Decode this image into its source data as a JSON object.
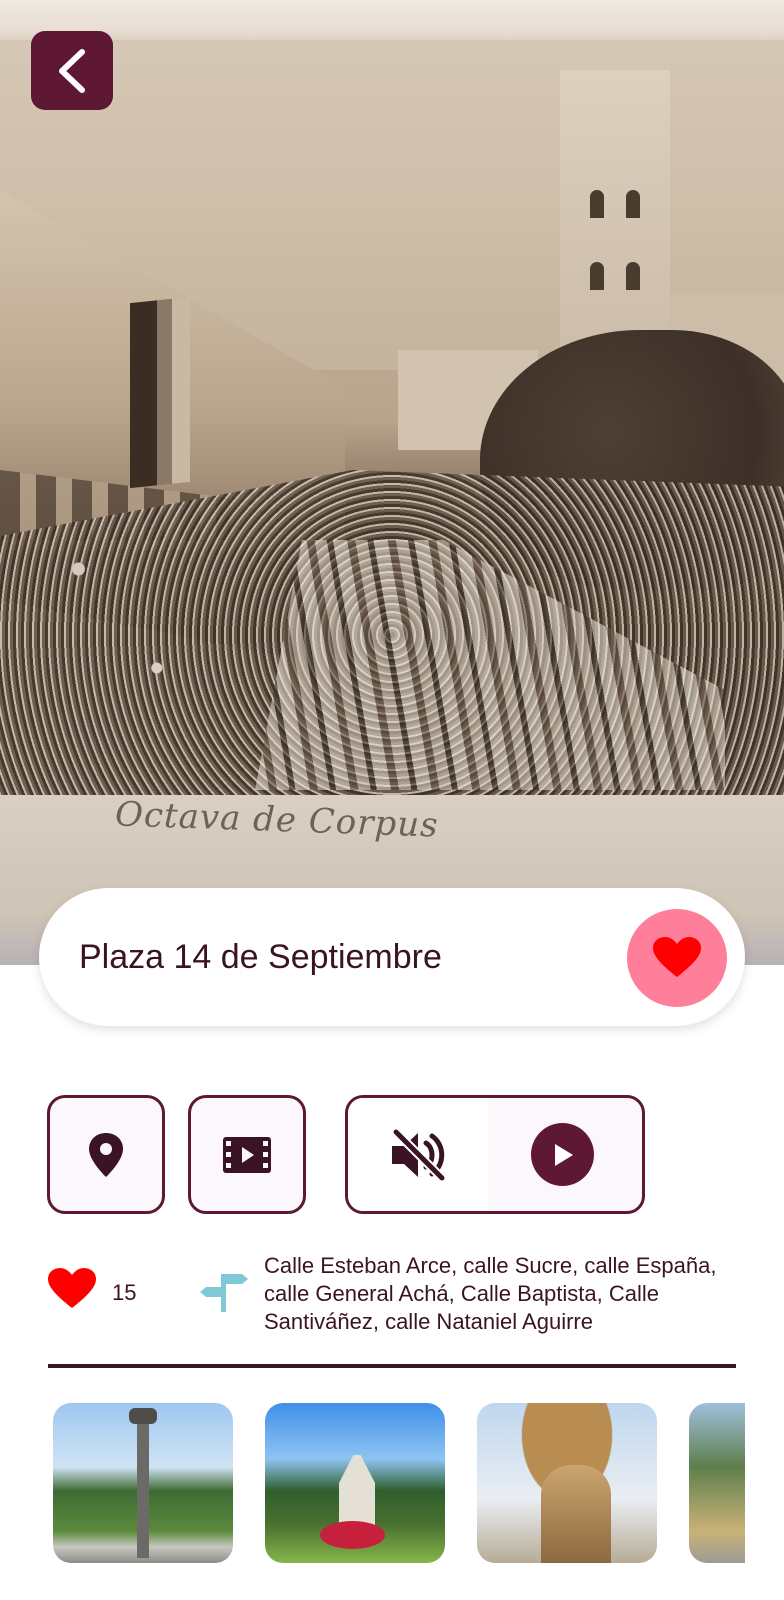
{
  "hero": {
    "image_alt": "Historical sepia photograph of a procession in the plaza",
    "caption": "Octava de Corpus"
  },
  "navigation": {
    "back_icon": "chevron-left-icon"
  },
  "place": {
    "title": "Plaza 14 de Septiembre",
    "favorite_icon": "heart-icon"
  },
  "actions": {
    "location_icon": "map-pin-icon",
    "video_icon": "film-icon",
    "mute_icon": "volume-mute-icon",
    "play_icon": "play-icon"
  },
  "info": {
    "likes_count": "15",
    "streets": "Calle Esteban Arce, calle Sucre, calle España, calle General Achá, Calle Baptista, Calle Santiváñez, calle Nataniel Aguirre"
  },
  "colors": {
    "primary": "#5e1833",
    "favorite_bg": "#ff7e9a",
    "heart": "#ff0000",
    "signpost": "#7ec8d8"
  },
  "gallery": {
    "items": [
      {
        "alt": "Plaza monument column"
      },
      {
        "alt": "Plaza gardens and cathedral"
      },
      {
        "alt": "Fountain with statues"
      },
      {
        "alt": "Plaza trees and buildings"
      }
    ]
  }
}
